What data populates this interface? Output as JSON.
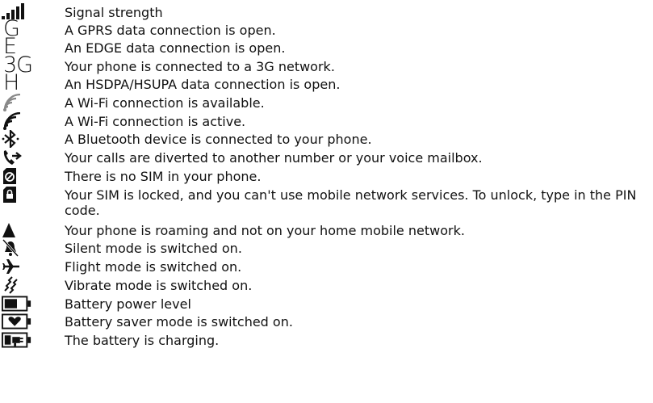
{
  "indicators": [
    {
      "icon": "signal-strength-icon",
      "text": "Signal strength"
    },
    {
      "icon": "gprs-icon",
      "glyph": "G",
      "text": "A GPRS data connection is open."
    },
    {
      "icon": "edge-icon",
      "glyph": "E",
      "text": "An EDGE data connection is open."
    },
    {
      "icon": "3g-icon",
      "glyph": "3G",
      "text": "Your phone is connected to a 3G network."
    },
    {
      "icon": "hsdpa-icon",
      "glyph": "H",
      "text": "An HSDPA/HSUPA data connection is open."
    },
    {
      "icon": "wifi-available-icon",
      "text": "A Wi-Fi connection is available."
    },
    {
      "icon": "wifi-active-icon",
      "text": "A Wi-Fi connection is active."
    },
    {
      "icon": "bluetooth-icon",
      "text": "A Bluetooth device is connected to your phone."
    },
    {
      "icon": "call-divert-icon",
      "text": "Your calls are diverted to another number or your voice mailbox."
    },
    {
      "icon": "no-sim-icon",
      "text": "There is no SIM in your phone."
    },
    {
      "icon": "sim-locked-icon",
      "text": "Your SIM is locked, and you can't use mobile network services. To unlock, type in the PIN code."
    },
    {
      "icon": "roaming-icon",
      "text": "Your phone is roaming and not on your home mobile network."
    },
    {
      "icon": "silent-mode-icon",
      "text": "Silent mode is switched on."
    },
    {
      "icon": "flight-mode-icon",
      "text": "Flight mode is switched on."
    },
    {
      "icon": "vibrate-mode-icon",
      "text": "Vibrate mode is switched on."
    },
    {
      "icon": "battery-level-icon",
      "text": "Battery power level"
    },
    {
      "icon": "battery-saver-icon",
      "text": "Battery saver mode is switched on."
    },
    {
      "icon": "battery-charging-icon",
      "text": "The battery is charging."
    }
  ]
}
